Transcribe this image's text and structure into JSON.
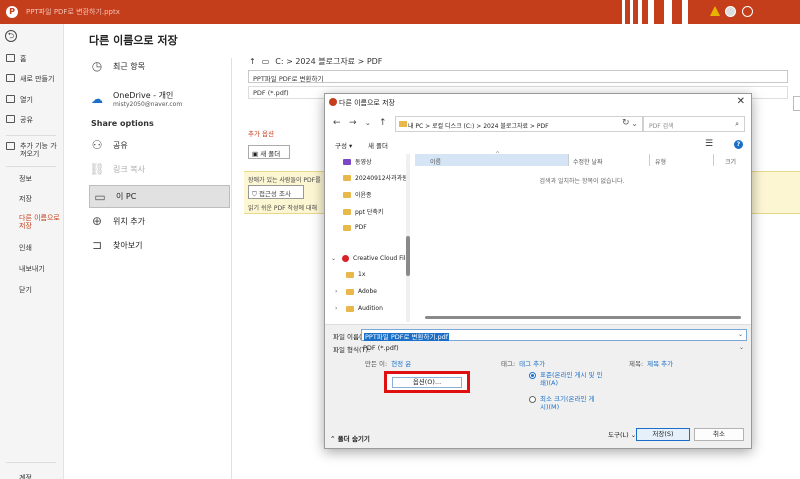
{
  "window": {
    "title": "PPT파일 PDF로 변환하기.pptx",
    "app_icon": "P",
    "icons": [
      "warning-icon",
      "avatar",
      "account-icon"
    ]
  },
  "leftnav": {
    "back_glyph": "⮌",
    "items": [
      {
        "label": "홈",
        "icon": "home-icon"
      },
      {
        "label": "새로 만들기",
        "icon": "new-file-icon"
      },
      {
        "label": "열기",
        "icon": "folder-open-icon"
      },
      {
        "label": "공유",
        "icon": "share-icon"
      },
      {
        "label": "추가 기능 가져오기",
        "icon": "addin-icon"
      }
    ],
    "plain_items": [
      "정보",
      "저장",
      "다른 이름으로 저장",
      "인쇄",
      "내보내기",
      "닫기"
    ],
    "bottom_item": "계정",
    "active_item": "다른 이름으로 저장",
    "active_color": "#c43e1c"
  },
  "saveas": {
    "title": "다른 이름으로 저장",
    "recent_label": "최근 항목",
    "onedrive_label": "OneDrive - 개인",
    "onedrive_email": "misty2050@naver.com",
    "share_options_label": "Share options",
    "share_label": "공유",
    "copy_link_label": "링크 복사",
    "this_pc_label": "이 PC",
    "add_place_label": "위치 추가",
    "browse_label": "찾아보기"
  },
  "rightpane": {
    "path": "C: > 2024 블로그자료 > PDF",
    "filename": "PPT파일 PDF로 변환하기",
    "filetype": "PDF (*.pdf)",
    "more_options": "추가 옵션",
    "new_folder": "새 폴더",
    "warning_text": "장애가 있는 사람들이 PDF를",
    "accessibility_btn": "접근성 조사",
    "readable_text": "읽기 쉬운 PDF 작성에 대해"
  },
  "dialog": {
    "title": "다른 이름으로 저장",
    "close_glyph": "✕",
    "address": "내 PC  >  로컬 디스크 (C:)  >  2024 블로그자료  >  PDF",
    "search_placeholder": "PDF 검색",
    "organize": "구성 ▾",
    "new_folder": "새 폴더",
    "tree": [
      {
        "label": "동영상",
        "icon": "video-folder-icon",
        "pinned": true
      },
      {
        "label": "20240912사과과원",
        "icon": "folder-icon"
      },
      {
        "label": "이윤종",
        "icon": "folder-icon"
      },
      {
        "label": "ppt 단축키",
        "icon": "folder-icon"
      },
      {
        "label": "PDF",
        "icon": "folder-icon"
      },
      {
        "label": "Creative Cloud File",
        "icon": "creative-cloud-icon",
        "expanded": true
      },
      {
        "label": "1x",
        "icon": "folder-icon"
      },
      {
        "label": "Adobe",
        "icon": "folder-icon"
      },
      {
        "label": "Audition",
        "icon": "folder-icon"
      }
    ],
    "columns": {
      "name": "이름",
      "date": "수정한 날짜",
      "type": "유형",
      "size": "크기"
    },
    "empty_message": "검색과 일치하는 항목이 없습니다.",
    "filename_label": "파일 이름(N):",
    "filename_value": "PPT파일 PDF로 변환하기.pdf",
    "filetype_label": "파일 형식(T):",
    "filetype_value": "PDF (*.pdf)",
    "author_key": "만든 이:",
    "author_value": "현정 윤",
    "tags_key": "태그:",
    "tags_value": "태그 추가",
    "subject_key": "제목:",
    "subject_value": "제목 추가",
    "options_btn": "옵션(O)...",
    "radio_standard": "표준(온라인 게시 및 인쇄)(A)",
    "radio_min": "최소 크기(온라인 게시)(M)",
    "hide_folders": "폴더 숨기기",
    "tools": "도구(L)",
    "save": "저장(S)",
    "cancel": "취소"
  },
  "colors": {
    "accent": "#c43e1c",
    "highlight": "#e01010",
    "link": "#1a6fc9"
  }
}
